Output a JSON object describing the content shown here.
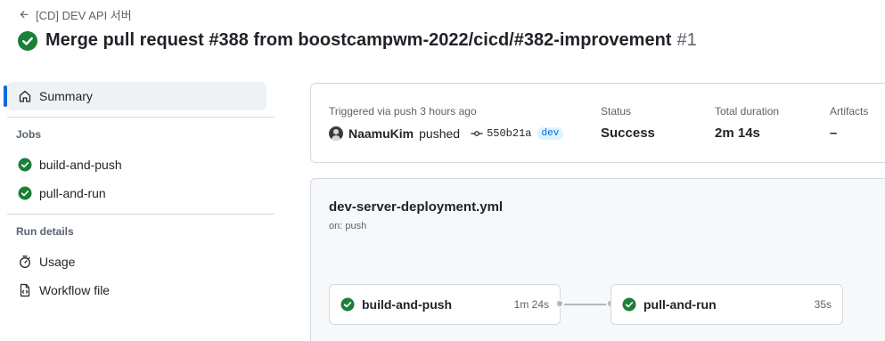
{
  "header": {
    "back_label": "[CD] DEV API 서버",
    "title": "Merge pull request #388 from boostcampwm-2022/cicd/#382-improvement",
    "run_number": "#1"
  },
  "sidebar": {
    "summary_label": "Summary",
    "jobs_heading": "Jobs",
    "jobs": [
      {
        "label": "build-and-push"
      },
      {
        "label": "pull-and-run"
      }
    ],
    "run_details_heading": "Run details",
    "details": [
      {
        "label": "Usage",
        "icon": "stopwatch-icon"
      },
      {
        "label": "Workflow file",
        "icon": "file-code-icon"
      }
    ]
  },
  "summary": {
    "trigger_text": "Triggered via push 3 hours ago",
    "user": "NaamuKim",
    "action": "pushed",
    "commit": "550b21a",
    "branch": "dev",
    "status_label": "Status",
    "status_value": "Success",
    "duration_label": "Total duration",
    "duration_value": "2m 14s",
    "artifacts_label": "Artifacts",
    "artifacts_value": "–"
  },
  "workflow": {
    "file_name": "dev-server-deployment.yml",
    "trigger": "on: push",
    "jobs": [
      {
        "name": "build-and-push",
        "duration": "1m 24s"
      },
      {
        "name": "pull-and-run",
        "duration": "35s"
      }
    ]
  },
  "colors": {
    "success": "#1a7f37",
    "accent": "#0969da",
    "border": "#d1d9e0",
    "muted": "#59636e"
  }
}
